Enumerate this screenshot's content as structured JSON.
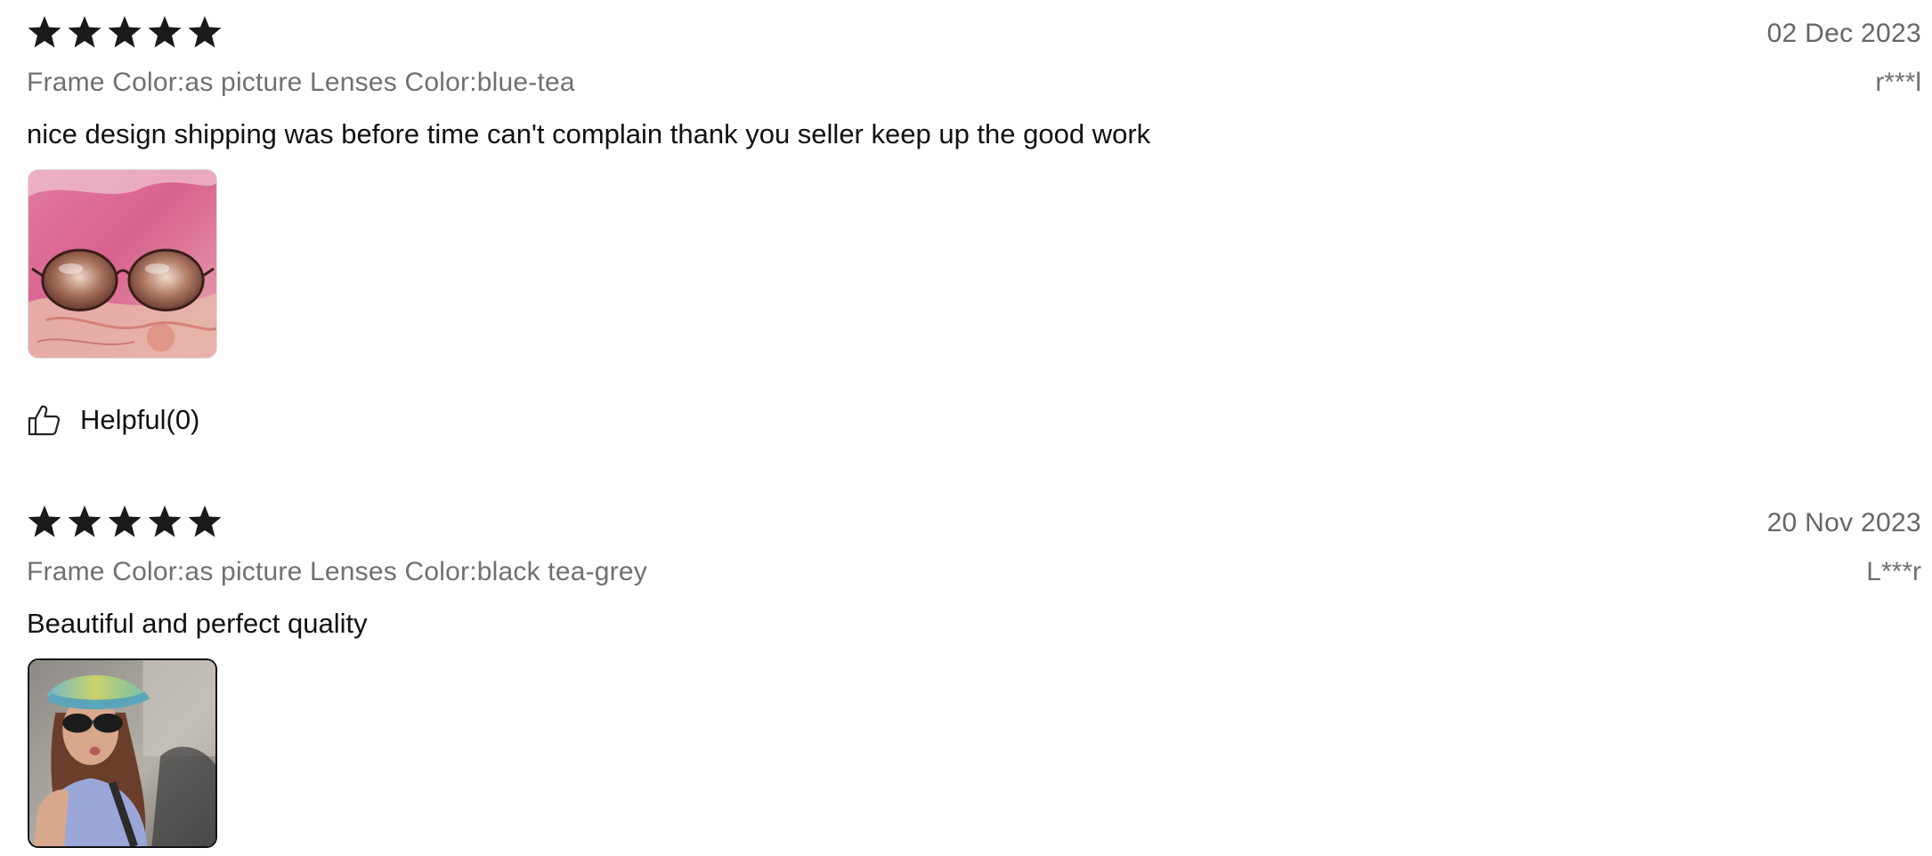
{
  "reviews": [
    {
      "rating": 5,
      "date": "02 Dec 2023",
      "sku": "Frame Color:as picture Lenses Color:blue-tea",
      "user": "r***l",
      "text": "nice design shipping was before time can't complain thank you seller keep up the good work",
      "photo": "review-photo",
      "helpful_label": "Helpful(0)"
    },
    {
      "rating": 5,
      "date": "20 Nov 2023",
      "sku": "Frame Color:as picture Lenses Color:black tea-grey",
      "user": "L***r",
      "text": "Beautiful and perfect quality",
      "photo": "review-photo"
    }
  ],
  "icons": {
    "star": "star-icon",
    "helpful": "thumbs-up-icon"
  },
  "colors": {
    "star": "#1a1a1a",
    "meta_text": "#707070",
    "body_text": "#111111"
  }
}
